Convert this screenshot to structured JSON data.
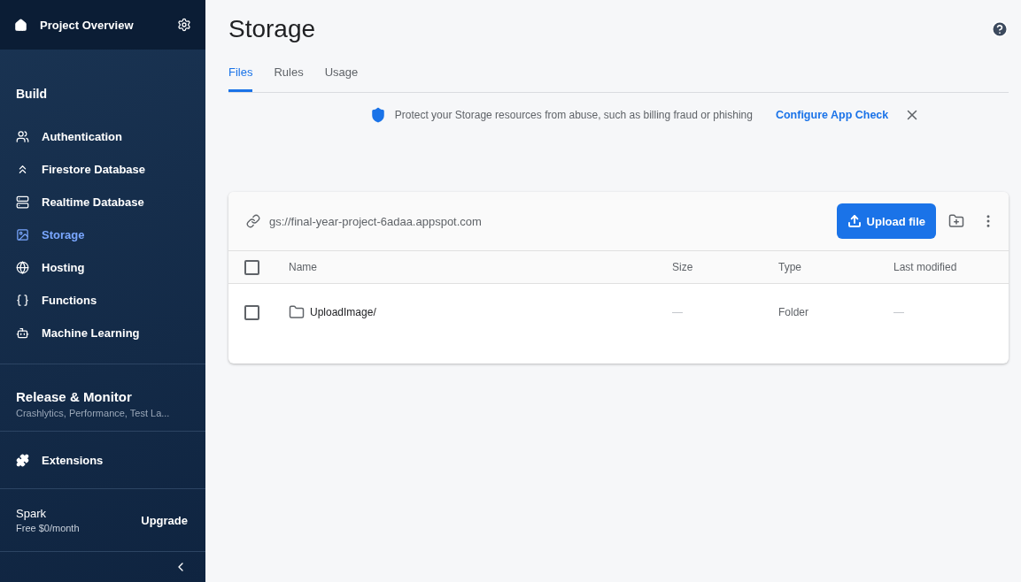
{
  "sidebar": {
    "header": {
      "title": "Project Overview"
    },
    "section_title": "Build",
    "items": [
      {
        "label": "Authentication",
        "selected": false
      },
      {
        "label": "Firestore Database",
        "selected": false
      },
      {
        "label": "Realtime Database",
        "selected": false
      },
      {
        "label": "Storage",
        "selected": true
      },
      {
        "label": "Hosting",
        "selected": false
      },
      {
        "label": "Functions",
        "selected": false
      },
      {
        "label": "Machine Learning",
        "selected": false
      }
    ],
    "release": {
      "title": "Release & Monitor",
      "subtitle": "Crashlytics, Performance, Test La..."
    },
    "extensions": {
      "label": "Extensions"
    },
    "plan": {
      "name": "Spark",
      "price": "Free $0/month",
      "action": "Upgrade"
    }
  },
  "page": {
    "title": "Storage",
    "tabs": [
      {
        "label": "Files",
        "selected": true
      },
      {
        "label": "Rules",
        "selected": false
      },
      {
        "label": "Usage",
        "selected": false
      }
    ],
    "banner": {
      "text": "Protect your Storage resources from abuse, such as billing fraud or phishing",
      "link": "Configure App Check"
    },
    "bucket": {
      "url": "gs://final-year-project-6adaa.appspot.com",
      "upload": "Upload file"
    },
    "table": {
      "select_all": {
        "checked": false
      },
      "columns": [
        "Name",
        "Size",
        "Type",
        "Last modified"
      ],
      "rows": [
        {
          "checked": false,
          "name": "UploadImage/",
          "size": "—",
          "type": "Folder",
          "modified": "—"
        }
      ]
    }
  }
}
